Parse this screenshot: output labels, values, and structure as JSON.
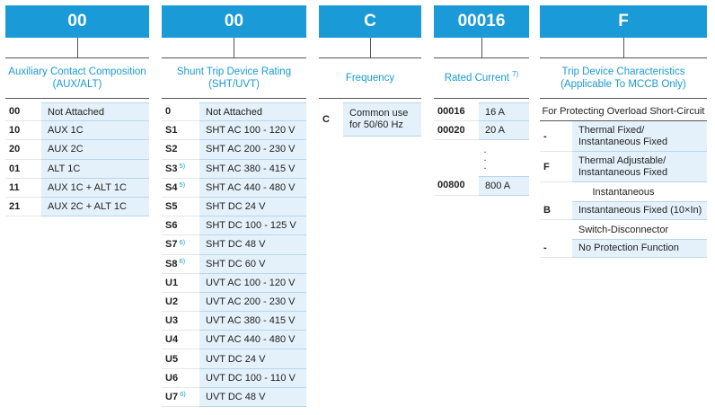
{
  "aux": {
    "header": "00",
    "title_line1": "Auxiliary Contact Composition",
    "title_line2": "(AUX/ALT)",
    "rows": [
      {
        "code": "00",
        "value": "Not Attached"
      },
      {
        "code": "10",
        "value": "AUX 1C"
      },
      {
        "code": "20",
        "value": "AUX 2C"
      },
      {
        "code": "01",
        "value": "ALT 1C"
      },
      {
        "code": "11",
        "value": "AUX 1C + ALT 1C"
      },
      {
        "code": "21",
        "value": "AUX 2C + ALT 1C"
      }
    ]
  },
  "shunt": {
    "header": "00",
    "title_line1": "Shunt Trip Device Rating",
    "title_line2": "(SHT/UVT)",
    "rows": [
      {
        "code": "0",
        "note": "",
        "value": "Not Attached"
      },
      {
        "code": "S1",
        "note": "",
        "value": "SHT AC 100 - 120 V"
      },
      {
        "code": "S2",
        "note": "",
        "value": "SHT AC 200 - 230 V"
      },
      {
        "code": "S3",
        "note": "5)",
        "value": "SHT AC 380 - 415 V"
      },
      {
        "code": "S4",
        "note": "5)",
        "value": "SHT AC 440 - 480 V"
      },
      {
        "code": "S5",
        "note": "",
        "value": "SHT DC 24 V"
      },
      {
        "code": "S6",
        "note": "",
        "value": "SHT DC 100 - 125 V"
      },
      {
        "code": "S7",
        "note": "6)",
        "value": "SHT DC 48 V"
      },
      {
        "code": "S8",
        "note": "6)",
        "value": "SHT DC 60 V"
      },
      {
        "code": "U1",
        "note": "",
        "value": "UVT AC 100 - 120 V"
      },
      {
        "code": "U2",
        "note": "",
        "value": "UVT AC 200 - 230 V"
      },
      {
        "code": "U3",
        "note": "",
        "value": "UVT AC 380 - 415 V"
      },
      {
        "code": "U4",
        "note": "",
        "value": "UVT AC 440 - 480 V"
      },
      {
        "code": "U5",
        "note": "",
        "value": "UVT DC 24 V"
      },
      {
        "code": "U6",
        "note": "",
        "value": "UVT DC 100 - 110 V"
      },
      {
        "code": "U7",
        "note": "6)",
        "value": "UVT DC 48 V"
      }
    ]
  },
  "frequency": {
    "header": "C",
    "title": "Frequency",
    "code": "C",
    "value_line1": "Common use",
    "value_line2": "for 50/60 Hz"
  },
  "current": {
    "header": "00016",
    "title": "Rated Current",
    "title_note": "7)",
    "rows_top": [
      {
        "code": "00016",
        "value": "16 A"
      },
      {
        "code": "00020",
        "value": "20 A"
      }
    ],
    "ellipsis": [
      ".",
      ".",
      "."
    ],
    "rows_bottom": [
      {
        "code": "00800",
        "value": "800 A"
      }
    ]
  },
  "trip": {
    "header": "F",
    "title_line1": "Trip Device Characteristics",
    "title_line2": "(Applicable To MCCB Only)",
    "section1": "For Protecting Overload Short-Circuit",
    "rows1": [
      {
        "code": "-",
        "line1": "Thermal Fixed/",
        "line2": "Instantaneous Fixed"
      },
      {
        "code": "F",
        "line1": "Thermal Adjustable/",
        "line2": "Instantaneous Fixed"
      }
    ],
    "section2": "Instantaneous",
    "row2": {
      "code": "B",
      "value": "Instantaneous Fixed (10×In)"
    },
    "section3": "Switch-Disconnector",
    "row3": {
      "code": "-",
      "value": "No Protection Function"
    }
  },
  "colors": {
    "accent": "#1a9ad6",
    "cell_bg": "#e4f1fa"
  }
}
